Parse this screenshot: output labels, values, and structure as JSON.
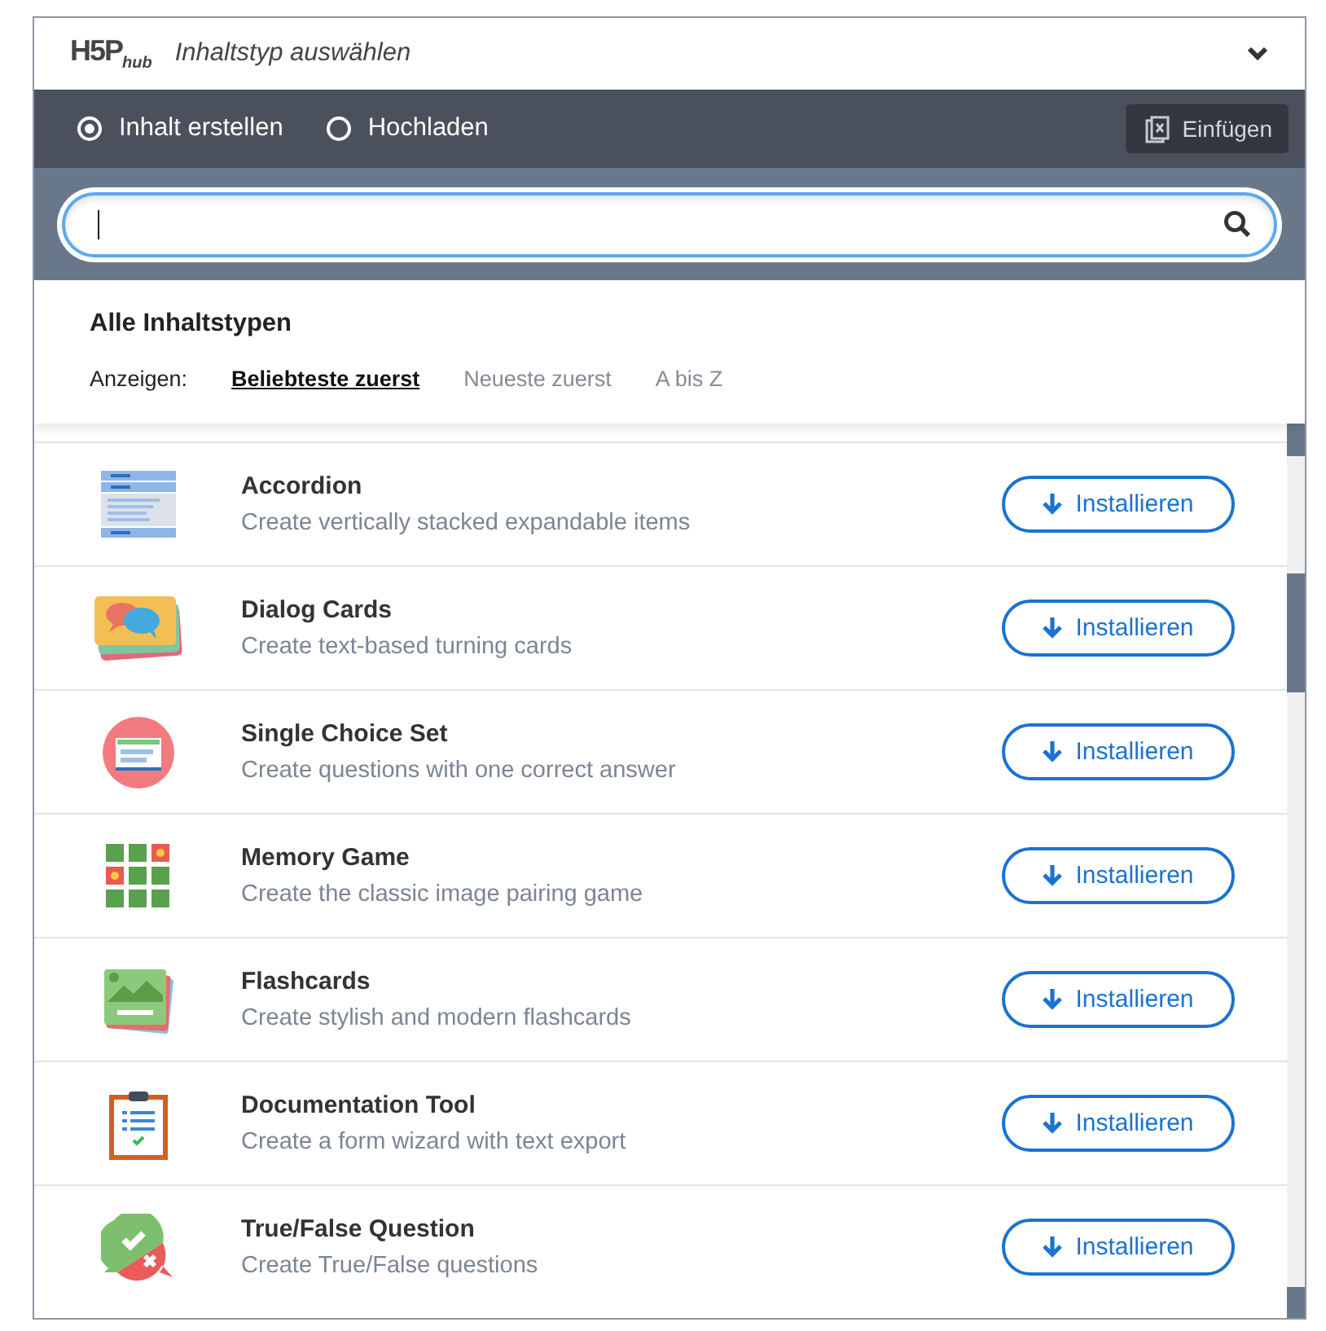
{
  "header": {
    "logo": "H5P",
    "logo_suffix": "hub",
    "title": "Inhaltstyp auswählen",
    "expanded": true
  },
  "tabs": [
    {
      "label": "Inhalt erstellen",
      "selected": true
    },
    {
      "label": "Hochladen",
      "selected": false
    }
  ],
  "paste_button": "Einfügen",
  "section_title": "Alle Inhaltstypen",
  "sort": {
    "label": "Anzeigen:",
    "options": [
      {
        "label": "Beliebteste zuerst",
        "selected": true
      },
      {
        "label": "Neueste zuerst",
        "selected": false
      },
      {
        "label": "A bis Z",
        "selected": false
      }
    ]
  },
  "content_types": [
    {
      "kind": "accordion",
      "title": "Accordion",
      "description": "Create vertically stacked expandable items",
      "button": "Installieren"
    },
    {
      "kind": "dialog-cards",
      "title": "Dialog Cards",
      "description": "Create text-based turning cards",
      "button": "Installieren"
    },
    {
      "kind": "single-choice",
      "title": "Single Choice Set",
      "description": "Create questions with one correct answer",
      "button": "Installieren"
    },
    {
      "kind": "memory",
      "title": "Memory Game",
      "description": "Create the classic image pairing game",
      "button": "Installieren"
    },
    {
      "kind": "flashcards",
      "title": "Flashcards",
      "description": "Create stylish and modern flashcards",
      "button": "Installieren"
    },
    {
      "kind": "documentation",
      "title": "Documentation Tool",
      "description": "Create a form wizard with text export",
      "button": "Installieren"
    },
    {
      "kind": "true-false",
      "title": "True/False Question",
      "description": "Create True/False questions",
      "button": "Installieren"
    }
  ]
}
